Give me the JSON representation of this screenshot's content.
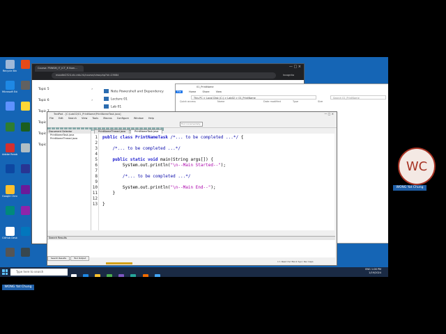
{
  "desktop_icons": [
    {
      "label": "Recycle Bin",
      "color": "#9fb8d8"
    },
    {
      "label": "Microsoft Edge",
      "color": "#1e88e5"
    },
    {
      "label": "",
      "color": "#5e92ff"
    },
    {
      "label": "",
      "color": "#2e7d32"
    },
    {
      "label": "Adobe Reader",
      "color": "#d32f2f"
    },
    {
      "label": "",
      "color": "#0d47a1"
    },
    {
      "label": "Google Chrome",
      "color": "#fbc02d"
    },
    {
      "label": "",
      "color": "#00897b"
    },
    {
      "label": "GitHub Desktop",
      "color": "#ffffff"
    },
    {
      "label": "",
      "color": "#555555"
    },
    {
      "label": "",
      "color": "#e64a19"
    },
    {
      "label": "",
      "color": "#616161"
    },
    {
      "label": "",
      "color": "#fdd835"
    },
    {
      "label": "",
      "color": "#1b5e20"
    },
    {
      "label": "",
      "color": "#b0bec5"
    },
    {
      "label": "",
      "color": "#283593"
    },
    {
      "label": "",
      "color": "#6a1b9a"
    },
    {
      "label": "",
      "color": "#8e24aa"
    },
    {
      "label": "",
      "color": "#0277bd"
    },
    {
      "label": "",
      "color": "#37474f"
    }
  ],
  "browser": {
    "tab": "Course: P5WSM_IT_ICT_R Num...",
    "url": "moodle2324.vtc.edu.hk/course/view.php?id=23684",
    "incognito": "Incognito",
    "topics": [
      "Topic 5",
      "Topic 6",
      "Topic 7",
      "Topic 8",
      "Topic 9",
      "Topic 10"
    ],
    "resources": [
      "Note Powershell and Dependency",
      "Lecture 01",
      "Lab 01"
    ]
  },
  "explorer": {
    "title": "01_PrintName",
    "ribbon": [
      "File",
      "Home",
      "Share",
      "View"
    ],
    "address": "This PC  >  Local Disk (C:)  >  Lab02  >  01_PrintName",
    "search_placeholder": "Search 01_PrintName",
    "quick_access": "Quick access",
    "columns": [
      "Name",
      "Date modified",
      "Type",
      "Size"
    ]
  },
  "textpad": {
    "title": "TextPad - [C:\\Lab02\\01_PrintName\\PrintNameTask.java]",
    "menu": [
      "File",
      "Edit",
      "Search",
      "View",
      "Tools",
      "Macros",
      "Configure",
      "Window",
      "Help"
    ],
    "find_placeholder": "Find incrementally",
    "doc_selector_title": "Document Selector",
    "files": [
      "PrintNameTask.java",
      "PrintNameThread.java"
    ],
    "tabs": [
      "PrintNameThread.java",
      "PrintNameTask.java"
    ],
    "line_numbers": [
      "1",
      "2",
      "3",
      "4",
      "5",
      "6",
      "7",
      "8",
      "9",
      "10",
      "11",
      "12",
      "13"
    ],
    "search_results_title": "Search Results",
    "bottom_tabs": [
      "Search Results",
      "Tool Output"
    ],
    "status": "1   1   Read  Ovr  Block  Sync  Rec  Caps"
  },
  "code": {
    "l1_kw": "public class",
    "l1_name": " PrintNameTask ",
    "l1_comment": "/*... to be completed ...*/",
    "l1_brace": " {",
    "l3": "    /*... to be completed ...*/",
    "l5_kw": "    public static void",
    "l5_rest": " main(String args[]) {",
    "l6_a": "        System.out.println(",
    "l6_s": "\"\\n--Main Started--\"",
    "l6_b": ");",
    "l8": "        /*... to be completed ...*/",
    "l10_a": "        System.out.println(",
    "l10_s": "\"\\n--Main End--\"",
    "l10_b": ");",
    "l11": "    }",
    "l13": "}"
  },
  "taskbar": {
    "search_placeholder": "Type here to search",
    "lang": "ENG",
    "time": "1:08 PM",
    "date": "1/19/2024"
  },
  "participant": {
    "initials": "WC",
    "name": "WONG Yat Chung"
  },
  "self_label": "WONG Yat Chung"
}
